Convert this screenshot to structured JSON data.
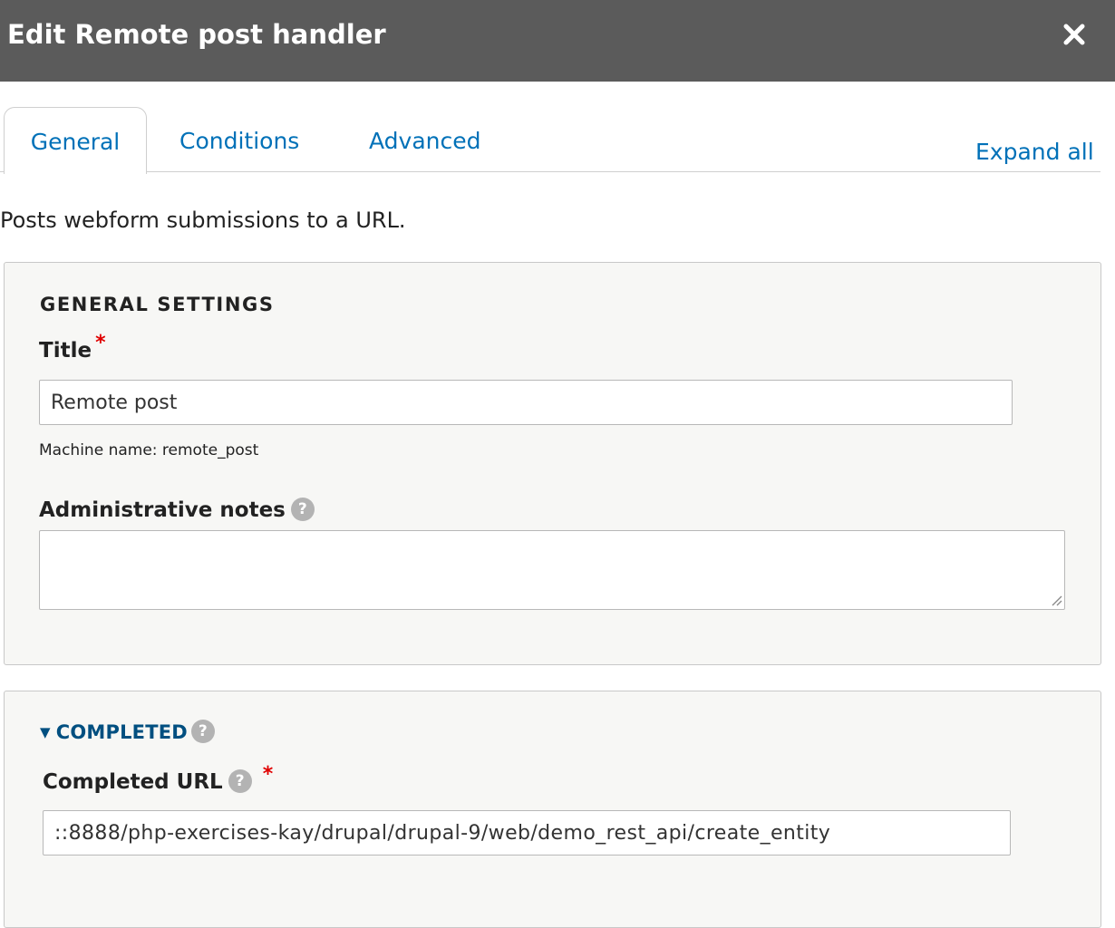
{
  "dialog": {
    "title": "Edit Remote post handler",
    "close_icon": "close-icon"
  },
  "tabs": [
    {
      "label": "General",
      "active": true
    },
    {
      "label": "Conditions",
      "active": false
    },
    {
      "label": "Advanced",
      "active": false
    }
  ],
  "expand_all": "Expand all",
  "description": "Posts webform submissions to a URL.",
  "general_settings": {
    "legend": "GENERAL SETTINGS",
    "title_label": "Title",
    "required_marker": "*",
    "title_value": "Remote post",
    "machine_name": "Machine name: remote_post",
    "notes_label": "Administrative notes",
    "help_glyph": "?"
  },
  "completed": {
    "summary": "COMPLETED",
    "triangle": "▼",
    "url_label": "Completed URL",
    "url_value": "::8888/php-exercises-kay/drupal/drupal-9/web/demo_rest_api/create_entity"
  },
  "colors": {
    "titlebar": "#5b5b5b",
    "link": "#0071b8",
    "summary_link": "#004f80",
    "required": "#e00000",
    "help_badge": "#b3b3b3",
    "fieldset_bg": "#f7f7f5"
  }
}
